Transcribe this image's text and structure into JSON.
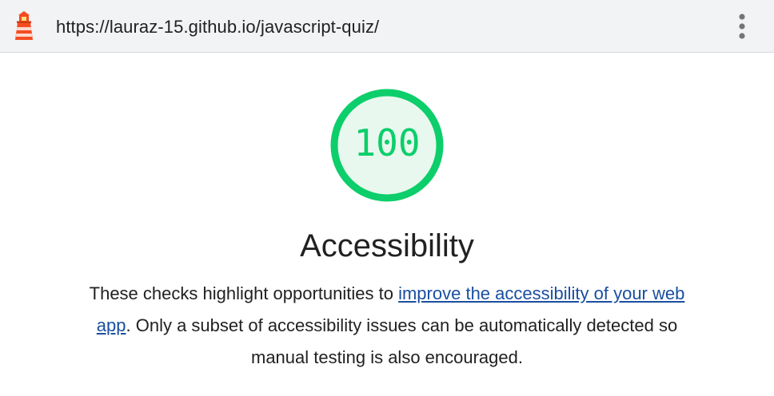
{
  "header": {
    "url": "https://lauraz-15.github.io/javascript-quiz/",
    "logo_icon": "lighthouse-icon",
    "menu_icon": "more-vertical-icon"
  },
  "category": {
    "score": "100",
    "score_fraction": 1.0,
    "title": "Accessibility",
    "description_before": "These checks highlight opportunities to ",
    "link_text": "improve the accessibility of your web app",
    "description_after": ". Only a subset of accessibility issues can be automatically detected so manual testing is also encouraged."
  },
  "colors": {
    "pass": "#0cce6b",
    "pass_bg": "#e8f8ee",
    "link": "#1a4fa0",
    "logo": "#f44b21"
  }
}
